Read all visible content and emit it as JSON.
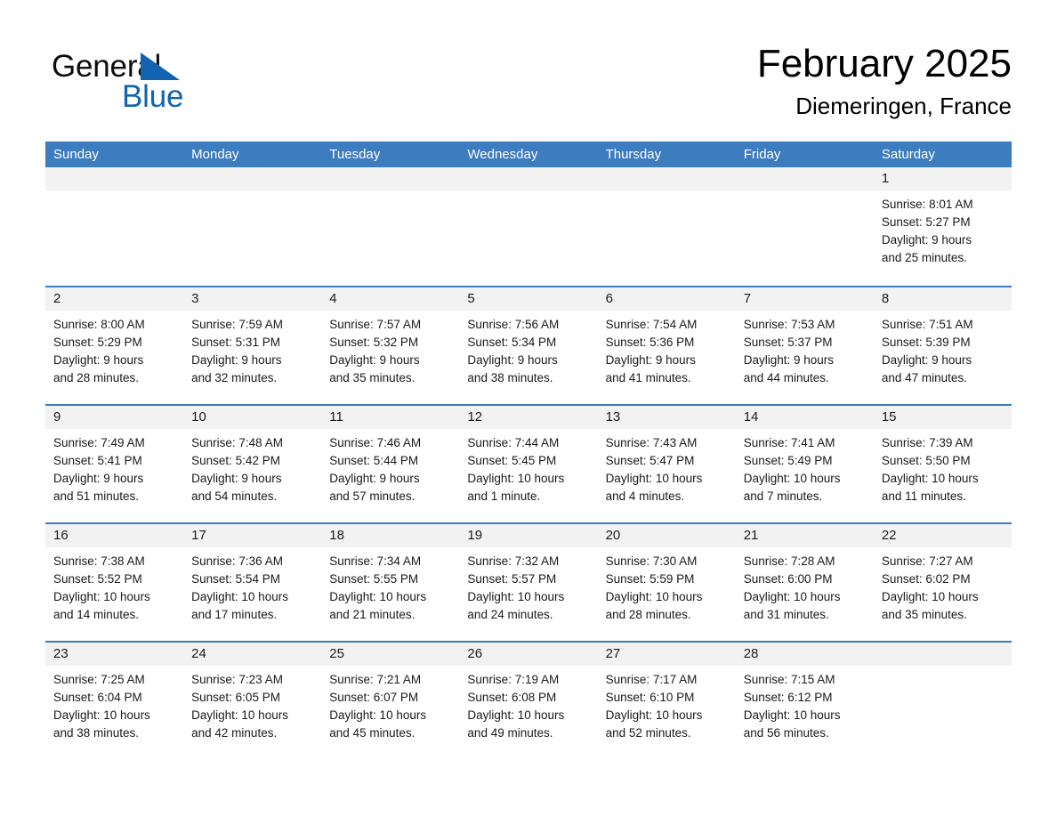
{
  "brand": {
    "line1": "General",
    "line2": "Blue",
    "triangle_color": "#1263b0"
  },
  "header": {
    "month_title": "February 2025",
    "location": "Diemeringen, France"
  },
  "theme": {
    "header_blue": "#3d7cbe",
    "band_gray": "#f2f2f2",
    "text": "#1a1a1a"
  },
  "weekdays": [
    "Sunday",
    "Monday",
    "Tuesday",
    "Wednesday",
    "Thursday",
    "Friday",
    "Saturday"
  ],
  "weeks": [
    [
      {
        "empty": true
      },
      {
        "empty": true
      },
      {
        "empty": true
      },
      {
        "empty": true
      },
      {
        "empty": true
      },
      {
        "empty": true
      },
      {
        "day": "1",
        "sunrise": "Sunrise: 8:01 AM",
        "sunset": "Sunset: 5:27 PM",
        "daylight1": "Daylight: 9 hours",
        "daylight2": "and 25 minutes."
      }
    ],
    [
      {
        "day": "2",
        "sunrise": "Sunrise: 8:00 AM",
        "sunset": "Sunset: 5:29 PM",
        "daylight1": "Daylight: 9 hours",
        "daylight2": "and 28 minutes."
      },
      {
        "day": "3",
        "sunrise": "Sunrise: 7:59 AM",
        "sunset": "Sunset: 5:31 PM",
        "daylight1": "Daylight: 9 hours",
        "daylight2": "and 32 minutes."
      },
      {
        "day": "4",
        "sunrise": "Sunrise: 7:57 AM",
        "sunset": "Sunset: 5:32 PM",
        "daylight1": "Daylight: 9 hours",
        "daylight2": "and 35 minutes."
      },
      {
        "day": "5",
        "sunrise": "Sunrise: 7:56 AM",
        "sunset": "Sunset: 5:34 PM",
        "daylight1": "Daylight: 9 hours",
        "daylight2": "and 38 minutes."
      },
      {
        "day": "6",
        "sunrise": "Sunrise: 7:54 AM",
        "sunset": "Sunset: 5:36 PM",
        "daylight1": "Daylight: 9 hours",
        "daylight2": "and 41 minutes."
      },
      {
        "day": "7",
        "sunrise": "Sunrise: 7:53 AM",
        "sunset": "Sunset: 5:37 PM",
        "daylight1": "Daylight: 9 hours",
        "daylight2": "and 44 minutes."
      },
      {
        "day": "8",
        "sunrise": "Sunrise: 7:51 AM",
        "sunset": "Sunset: 5:39 PM",
        "daylight1": "Daylight: 9 hours",
        "daylight2": "and 47 minutes."
      }
    ],
    [
      {
        "day": "9",
        "sunrise": "Sunrise: 7:49 AM",
        "sunset": "Sunset: 5:41 PM",
        "daylight1": "Daylight: 9 hours",
        "daylight2": "and 51 minutes."
      },
      {
        "day": "10",
        "sunrise": "Sunrise: 7:48 AM",
        "sunset": "Sunset: 5:42 PM",
        "daylight1": "Daylight: 9 hours",
        "daylight2": "and 54 minutes."
      },
      {
        "day": "11",
        "sunrise": "Sunrise: 7:46 AM",
        "sunset": "Sunset: 5:44 PM",
        "daylight1": "Daylight: 9 hours",
        "daylight2": "and 57 minutes."
      },
      {
        "day": "12",
        "sunrise": "Sunrise: 7:44 AM",
        "sunset": "Sunset: 5:45 PM",
        "daylight1": "Daylight: 10 hours",
        "daylight2": "and 1 minute."
      },
      {
        "day": "13",
        "sunrise": "Sunrise: 7:43 AM",
        "sunset": "Sunset: 5:47 PM",
        "daylight1": "Daylight: 10 hours",
        "daylight2": "and 4 minutes."
      },
      {
        "day": "14",
        "sunrise": "Sunrise: 7:41 AM",
        "sunset": "Sunset: 5:49 PM",
        "daylight1": "Daylight: 10 hours",
        "daylight2": "and 7 minutes."
      },
      {
        "day": "15",
        "sunrise": "Sunrise: 7:39 AM",
        "sunset": "Sunset: 5:50 PM",
        "daylight1": "Daylight: 10 hours",
        "daylight2": "and 11 minutes."
      }
    ],
    [
      {
        "day": "16",
        "sunrise": "Sunrise: 7:38 AM",
        "sunset": "Sunset: 5:52 PM",
        "daylight1": "Daylight: 10 hours",
        "daylight2": "and 14 minutes."
      },
      {
        "day": "17",
        "sunrise": "Sunrise: 7:36 AM",
        "sunset": "Sunset: 5:54 PM",
        "daylight1": "Daylight: 10 hours",
        "daylight2": "and 17 minutes."
      },
      {
        "day": "18",
        "sunrise": "Sunrise: 7:34 AM",
        "sunset": "Sunset: 5:55 PM",
        "daylight1": "Daylight: 10 hours",
        "daylight2": "and 21 minutes."
      },
      {
        "day": "19",
        "sunrise": "Sunrise: 7:32 AM",
        "sunset": "Sunset: 5:57 PM",
        "daylight1": "Daylight: 10 hours",
        "daylight2": "and 24 minutes."
      },
      {
        "day": "20",
        "sunrise": "Sunrise: 7:30 AM",
        "sunset": "Sunset: 5:59 PM",
        "daylight1": "Daylight: 10 hours",
        "daylight2": "and 28 minutes."
      },
      {
        "day": "21",
        "sunrise": "Sunrise: 7:28 AM",
        "sunset": "Sunset: 6:00 PM",
        "daylight1": "Daylight: 10 hours",
        "daylight2": "and 31 minutes."
      },
      {
        "day": "22",
        "sunrise": "Sunrise: 7:27 AM",
        "sunset": "Sunset: 6:02 PM",
        "daylight1": "Daylight: 10 hours",
        "daylight2": "and 35 minutes."
      }
    ],
    [
      {
        "day": "23",
        "sunrise": "Sunrise: 7:25 AM",
        "sunset": "Sunset: 6:04 PM",
        "daylight1": "Daylight: 10 hours",
        "daylight2": "and 38 minutes."
      },
      {
        "day": "24",
        "sunrise": "Sunrise: 7:23 AM",
        "sunset": "Sunset: 6:05 PM",
        "daylight1": "Daylight: 10 hours",
        "daylight2": "and 42 minutes."
      },
      {
        "day": "25",
        "sunrise": "Sunrise: 7:21 AM",
        "sunset": "Sunset: 6:07 PM",
        "daylight1": "Daylight: 10 hours",
        "daylight2": "and 45 minutes."
      },
      {
        "day": "26",
        "sunrise": "Sunrise: 7:19 AM",
        "sunset": "Sunset: 6:08 PM",
        "daylight1": "Daylight: 10 hours",
        "daylight2": "and 49 minutes."
      },
      {
        "day": "27",
        "sunrise": "Sunrise: 7:17 AM",
        "sunset": "Sunset: 6:10 PM",
        "daylight1": "Daylight: 10 hours",
        "daylight2": "and 52 minutes."
      },
      {
        "day": "28",
        "sunrise": "Sunrise: 7:15 AM",
        "sunset": "Sunset: 6:12 PM",
        "daylight1": "Daylight: 10 hours",
        "daylight2": "and 56 minutes."
      },
      {
        "empty": true
      }
    ]
  ]
}
